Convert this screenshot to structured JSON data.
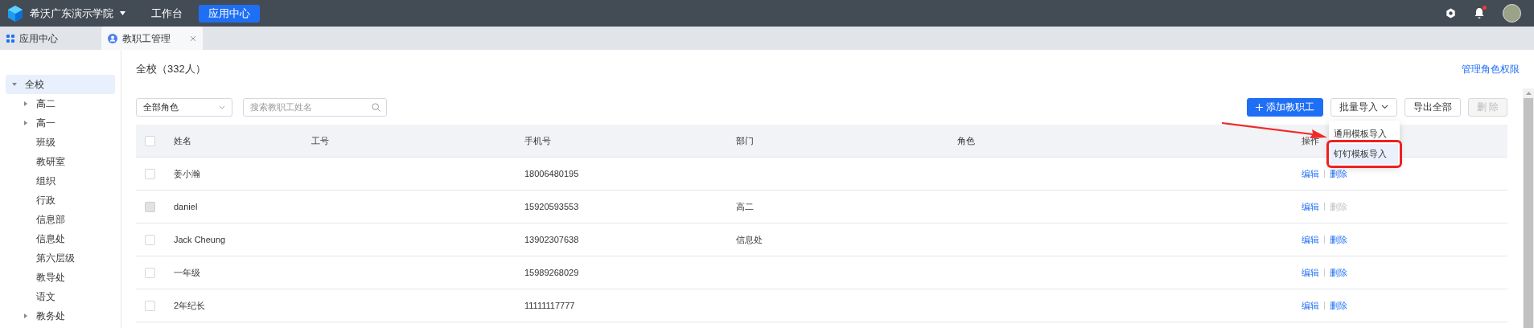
{
  "top_bar": {
    "org_name": "希沃广东演示学院",
    "nav": [
      {
        "label": "工作台",
        "selected": false
      },
      {
        "label": "应用中心",
        "selected": true
      }
    ],
    "notification_unread": true
  },
  "tabs": [
    {
      "label": "应用中心",
      "selected": false,
      "closable": false
    },
    {
      "label": "教职工管理",
      "selected": true,
      "closable": true
    }
  ],
  "sidebar": {
    "items": [
      {
        "label": "全校",
        "selected": true,
        "expandable": true,
        "expanded": true,
        "children": [
          {
            "label": "高二",
            "selected": false,
            "expandable": true,
            "expanded": false
          },
          {
            "label": "高一",
            "selected": false,
            "expandable": true,
            "expanded": false
          },
          {
            "label": "班级",
            "selected": false,
            "expandable": false,
            "expanded": false
          },
          {
            "label": "教研室",
            "selected": false,
            "expandable": false,
            "expanded": false
          },
          {
            "label": "组织",
            "selected": false,
            "expandable": false,
            "expanded": false
          },
          {
            "label": "行政",
            "selected": false,
            "expandable": false,
            "expanded": false
          },
          {
            "label": "信息部",
            "selected": false,
            "expandable": false,
            "expanded": false
          },
          {
            "label": "信息处",
            "selected": false,
            "expandable": false,
            "expanded": false
          },
          {
            "label": "第六层级",
            "selected": false,
            "expandable": false,
            "expanded": false
          },
          {
            "label": "教导处",
            "selected": false,
            "expandable": false,
            "expanded": false
          },
          {
            "label": "语文",
            "selected": false,
            "expandable": false,
            "expanded": false
          },
          {
            "label": "教务处",
            "selected": false,
            "expandable": true,
            "expanded": false
          }
        ]
      }
    ]
  },
  "page_title": "全校（332人）",
  "manage_roles_link": "管理角色权限",
  "filters": {
    "role_select": "全部角色",
    "search": {
      "placeholder": "搜索教职工姓名"
    }
  },
  "actions": [
    {
      "label": "添加教职工",
      "kind": "primary",
      "disabled": false
    },
    {
      "label": "批量导入",
      "kind": "dropdown",
      "disabled": false
    },
    {
      "label": "导出全部",
      "kind": "default",
      "disabled": false
    },
    {
      "label": "删 除",
      "kind": "default",
      "disabled": true
    }
  ],
  "import_menu": {
    "items": [
      {
        "label": "通用模板导入",
        "selected": false
      },
      {
        "label": "钉钉模板导入",
        "selected": true
      }
    ]
  },
  "table": {
    "columns": [
      "姓名",
      "工号",
      "手机号",
      "部门",
      "角色",
      "操作"
    ],
    "header_checked": false,
    "rows": [
      {
        "checked": false,
        "checkbox_disabled": false,
        "name": "姜小瀚",
        "phone": "18006480195",
        "edit": "编辑",
        "delete": "删除",
        "delete_disabled": false
      },
      {
        "checked": false,
        "checkbox_disabled": true,
        "name": "daniel",
        "phone": "15920593553",
        "department": "高二",
        "edit": "编辑",
        "delete": "删除",
        "delete_disabled": true
      },
      {
        "checked": false,
        "checkbox_disabled": false,
        "name": "Jack Cheung",
        "phone": "13902307638",
        "department": "信息处",
        "edit": "编辑",
        "delete": "删除",
        "delete_disabled": false
      },
      {
        "checked": false,
        "checkbox_disabled": false,
        "name": "一年级",
        "phone": "15989268029",
        "edit": "编辑",
        "delete": "删除",
        "delete_disabled": false
      },
      {
        "checked": false,
        "checkbox_disabled": false,
        "name": "2年纪长",
        "phone": "11111117777",
        "edit": "编辑",
        "delete": "删除",
        "delete_disabled": false
      }
    ]
  }
}
